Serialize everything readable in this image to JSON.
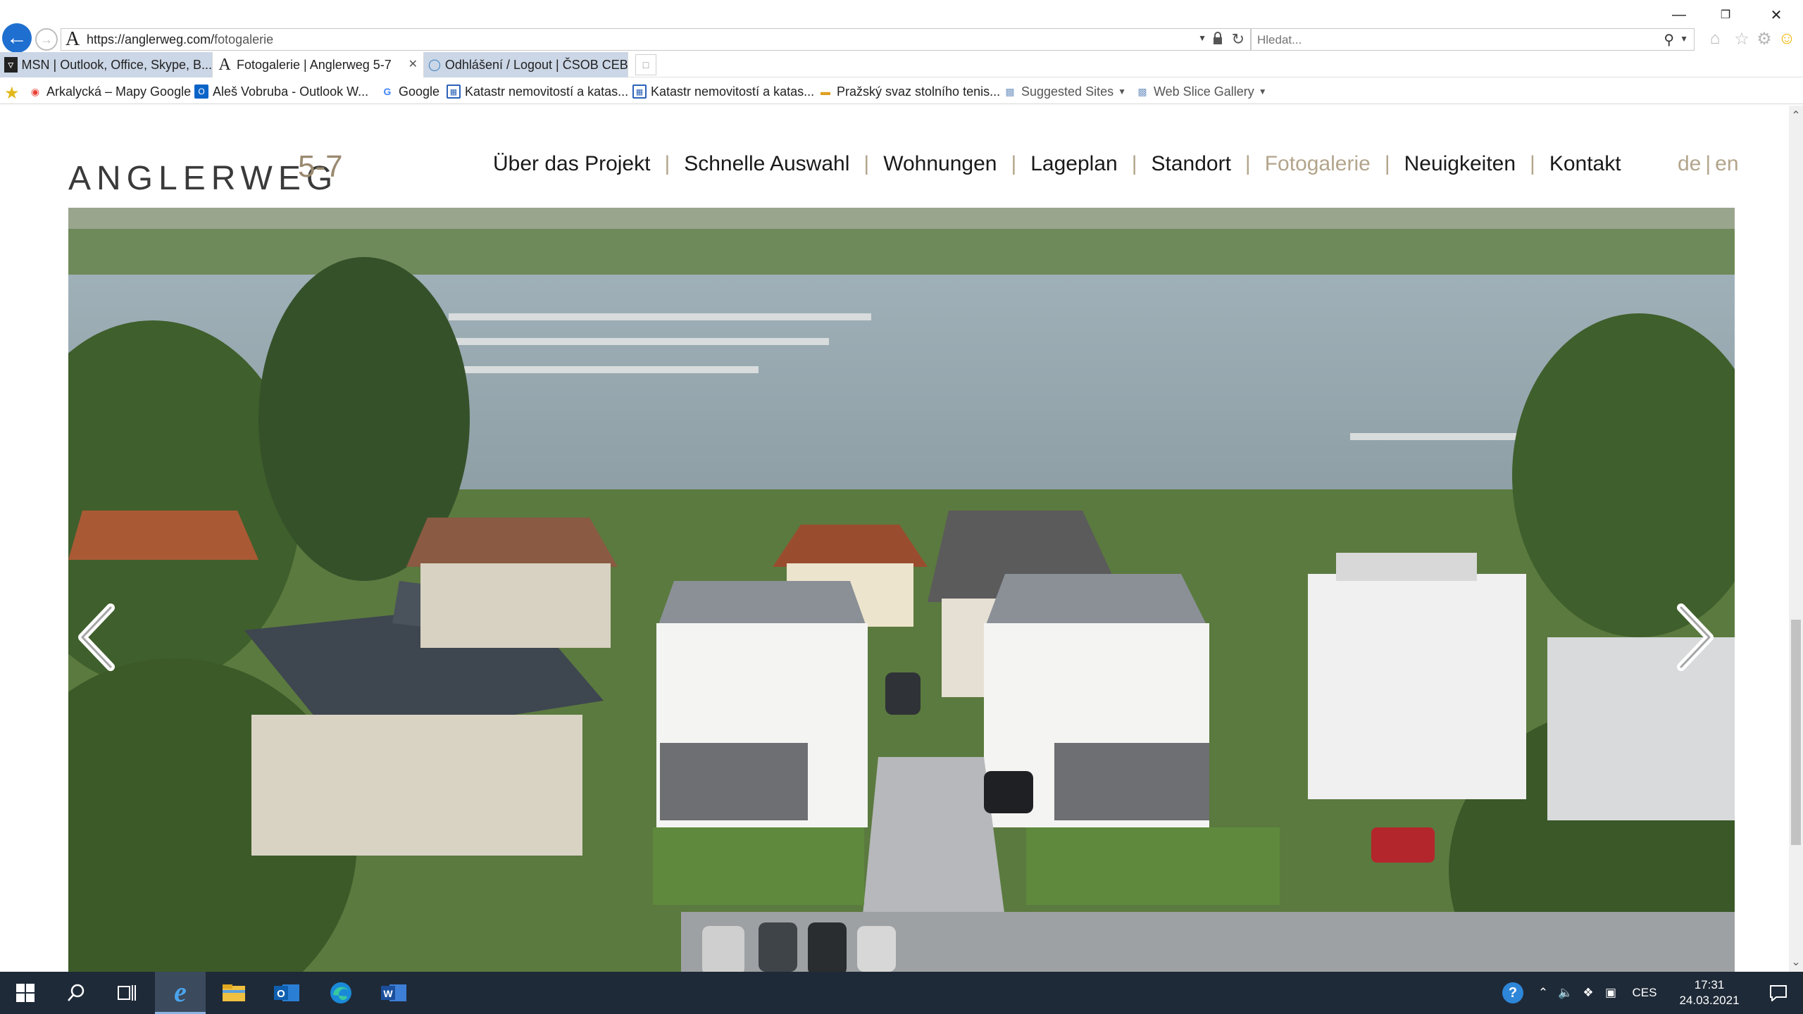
{
  "browser": {
    "url_prefix": "https://anglerweg.com/",
    "url_path": "fotogalerie",
    "search_placeholder": "Hledat...",
    "tabs": [
      {
        "label": "MSN | Outlook, Office, Skype, B...",
        "active": false
      },
      {
        "label": "Fotogalerie | Anglerweg 5-7",
        "active": true
      },
      {
        "label": "Odhlášení / Logout | ČSOB CEB",
        "active": false
      }
    ],
    "favorites": [
      {
        "label": "Arkalycká – Mapy Google",
        "icon": "map-pin-icon"
      },
      {
        "label": "Aleš Vobruba - Outlook W...",
        "icon": "outlook-icon"
      },
      {
        "label": "Google",
        "icon": "google-icon"
      },
      {
        "label": "Katastr nemovitostí a katas...",
        "icon": "katastr-icon"
      },
      {
        "label": "Katastr nemovitostí a katas...",
        "icon": "katastr-icon"
      },
      {
        "label": "Pražský svaz stolního tenis...",
        "icon": "folder-icon"
      },
      {
        "label": "Suggested Sites",
        "icon": "ie-page-icon",
        "dropdown": true
      },
      {
        "label": "Web Slice Gallery",
        "icon": "ie-page-icon",
        "dropdown": true
      }
    ]
  },
  "site": {
    "logo_text": "ANGLERWEG",
    "logo_sup": "5-7",
    "nav": [
      {
        "label": "Über das Projekt",
        "current": false
      },
      {
        "label": "Schnelle Auswahl",
        "current": false
      },
      {
        "label": "Wohnungen",
        "current": false
      },
      {
        "label": "Lageplan",
        "current": false
      },
      {
        "label": "Standort",
        "current": false
      },
      {
        "label": "Fotogalerie",
        "current": true
      },
      {
        "label": "Neuigkeiten",
        "current": false
      },
      {
        "label": "Kontakt",
        "current": false
      }
    ],
    "nav_separator": "|",
    "lang": {
      "de": "de",
      "sep": "|",
      "en": "en"
    },
    "colors": {
      "accent": "#b3a58c",
      "text": "#1a1a1a"
    }
  },
  "taskbar": {
    "lang": "CES",
    "time": "17:31",
    "date": "24.03.2021"
  }
}
